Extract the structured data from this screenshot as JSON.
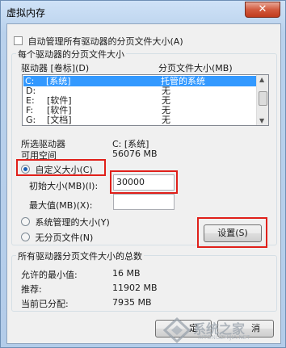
{
  "window": {
    "title": "虚拟内存",
    "close_glyph": "✕"
  },
  "auto_manage": {
    "label": "自动管理所有驱动器的分页文件大小(A)",
    "checked": false
  },
  "per_drive_group": "每个驱动器的分页文件大小",
  "columns": {
    "drive": "驱动器 [卷标](D)",
    "size": "分页文件大小(MB)"
  },
  "drives": [
    {
      "drive": "C:",
      "label": "[系统]",
      "size": "托管的系统",
      "selected": true
    },
    {
      "drive": "D:",
      "label": "",
      "size": "无",
      "selected": false
    },
    {
      "drive": "E:",
      "label": "[软件]",
      "size": "无",
      "selected": false
    },
    {
      "drive": "F:",
      "label": "[软件]",
      "size": "无",
      "selected": false
    },
    {
      "drive": "G:",
      "label": "[文档]",
      "size": "无",
      "selected": false
    }
  ],
  "selected_drive": {
    "label": "所选驱动器",
    "value": "C:  [系统]"
  },
  "free_space": {
    "label": "可用空间",
    "value": "56076 MB"
  },
  "custom_size": {
    "label": "自定义大小(C)",
    "selected": true
  },
  "initial_size": {
    "label": "初始大小(MB)(I):",
    "value": "30000"
  },
  "max_size": {
    "label": "最大值(MB)(X):",
    "value": ""
  },
  "system_managed": {
    "label": "系统管理的大小(Y)",
    "selected": false
  },
  "no_paging": {
    "label": "无分页文件(N)",
    "selected": false
  },
  "set_button": "设置(S)",
  "total_group": "所有驱动器分页文件大小的总数",
  "totals": [
    {
      "label": "允许的最小值:",
      "value": "16 MB"
    },
    {
      "label": "推荐:",
      "value": "11902 MB"
    },
    {
      "label": "当前已分配:",
      "value": "7935 MB"
    }
  ],
  "bottom_buttons": {
    "ok": "定",
    "cancel": "消"
  },
  "watermark": {
    "text": "系统之家",
    "sub": "XITONGZHIJIA.NET"
  },
  "colors": {
    "selection": "#3399ff",
    "highlight_box": "#e0201a",
    "close": "#c03a1d"
  }
}
